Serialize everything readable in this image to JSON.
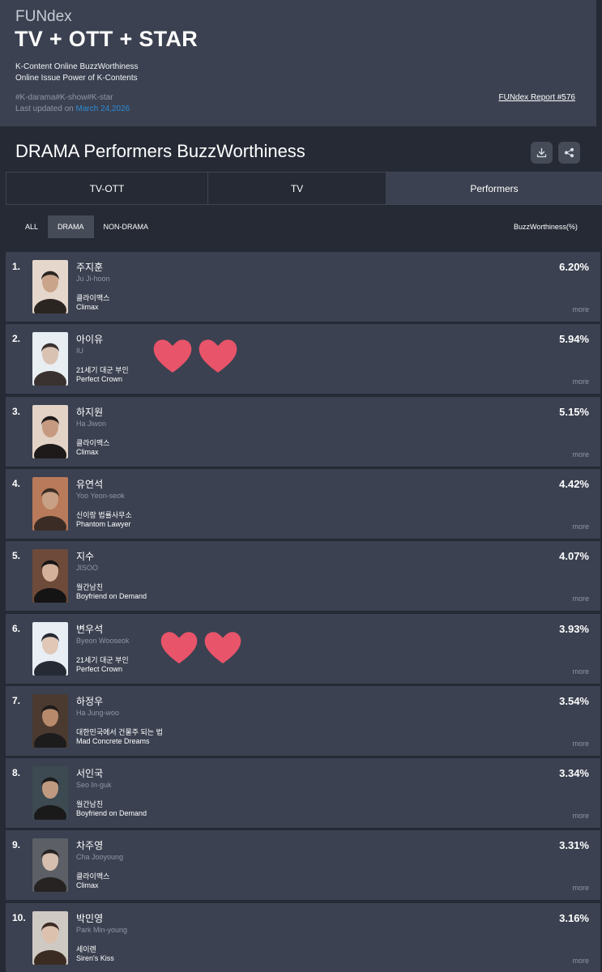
{
  "header": {
    "brand": "FUNdex",
    "title": "TV + OTT + STAR",
    "description_line1": "K-Content Online BuzzWorthiness",
    "description_line2": "Online Issue Power of K-Contents",
    "hashtags": "#K-darama#K-show#K-star",
    "updated_label": "Last updated on ",
    "updated_date": "March 24,2026",
    "report_link": "FUNdex Report #576"
  },
  "section": {
    "title": "DRAMA Performers BuzzWorthiness",
    "download_icon": "download-icon",
    "share_icon": "share-icon"
  },
  "tabs": [
    {
      "label": "TV-OTT",
      "active": false
    },
    {
      "label": "TV",
      "active": false
    },
    {
      "label": "Performers",
      "active": true
    }
  ],
  "filters": [
    {
      "label": "ALL",
      "active": false
    },
    {
      "label": "DRAMA",
      "active": true
    },
    {
      "label": "NON-DRAMA",
      "active": false
    }
  ],
  "column_header": "BuzzWorthiness(%)",
  "rankings": [
    {
      "rank": "1.",
      "name_kr": "주지훈",
      "name_en": "Ju Ji-hoon",
      "show_kr": "클라이맥스",
      "show_en": "Climax",
      "pct": "6.20%",
      "more": "more"
    },
    {
      "rank": "2.",
      "name_kr": "아이유",
      "name_en": "IU",
      "show_kr": "21세기 대군 부인",
      "show_en": "Perfect Crown",
      "pct": "5.94%",
      "more": "more"
    },
    {
      "rank": "3.",
      "name_kr": "하지원",
      "name_en": "Ha Jiwon",
      "show_kr": "클라이맥스",
      "show_en": "Climax",
      "pct": "5.15%",
      "more": "more"
    },
    {
      "rank": "4.",
      "name_kr": "유연석",
      "name_en": "Yoo Yeon-seok",
      "show_kr": "신이랑 법률사무소",
      "show_en": "Phantom Lawyer",
      "pct": "4.42%",
      "more": "more"
    },
    {
      "rank": "5.",
      "name_kr": "지수",
      "name_en": "JISOO",
      "show_kr": "월간남친",
      "show_en": "Boyfriend on Demand",
      "pct": "4.07%",
      "more": "more"
    },
    {
      "rank": "6.",
      "name_kr": "변우석",
      "name_en": "Byeon Wooseok",
      "show_kr": "21세기 대군 부인",
      "show_en": "Perfect Crown",
      "pct": "3.93%",
      "more": "more"
    },
    {
      "rank": "7.",
      "name_kr": "하정우",
      "name_en": "Ha Jung-woo",
      "show_kr": "대한민국에서 건물주 되는 법",
      "show_en": "Mad Concrete Dreams",
      "pct": "3.54%",
      "more": "more"
    },
    {
      "rank": "8.",
      "name_kr": "서인국",
      "name_en": "Seo In-guk",
      "show_kr": "월간남친",
      "show_en": "Boyfriend on Demand",
      "pct": "3.34%",
      "more": "more"
    },
    {
      "rank": "9.",
      "name_kr": "차주영",
      "name_en": "Cha Jooyoung",
      "show_kr": "클라이맥스",
      "show_en": "Climax",
      "pct": "3.31%",
      "more": "more"
    },
    {
      "rank": "10.",
      "name_kr": "박민영",
      "name_en": "Park Min-young",
      "show_kr": "세이렌",
      "show_en": "Siren's Kiss",
      "pct": "3.16%",
      "more": "more"
    }
  ],
  "colors": {
    "page_bg": "#252a35",
    "panel_bg": "#3b4150",
    "accent_link": "#2d8ad6",
    "heart": "#e8546a"
  }
}
